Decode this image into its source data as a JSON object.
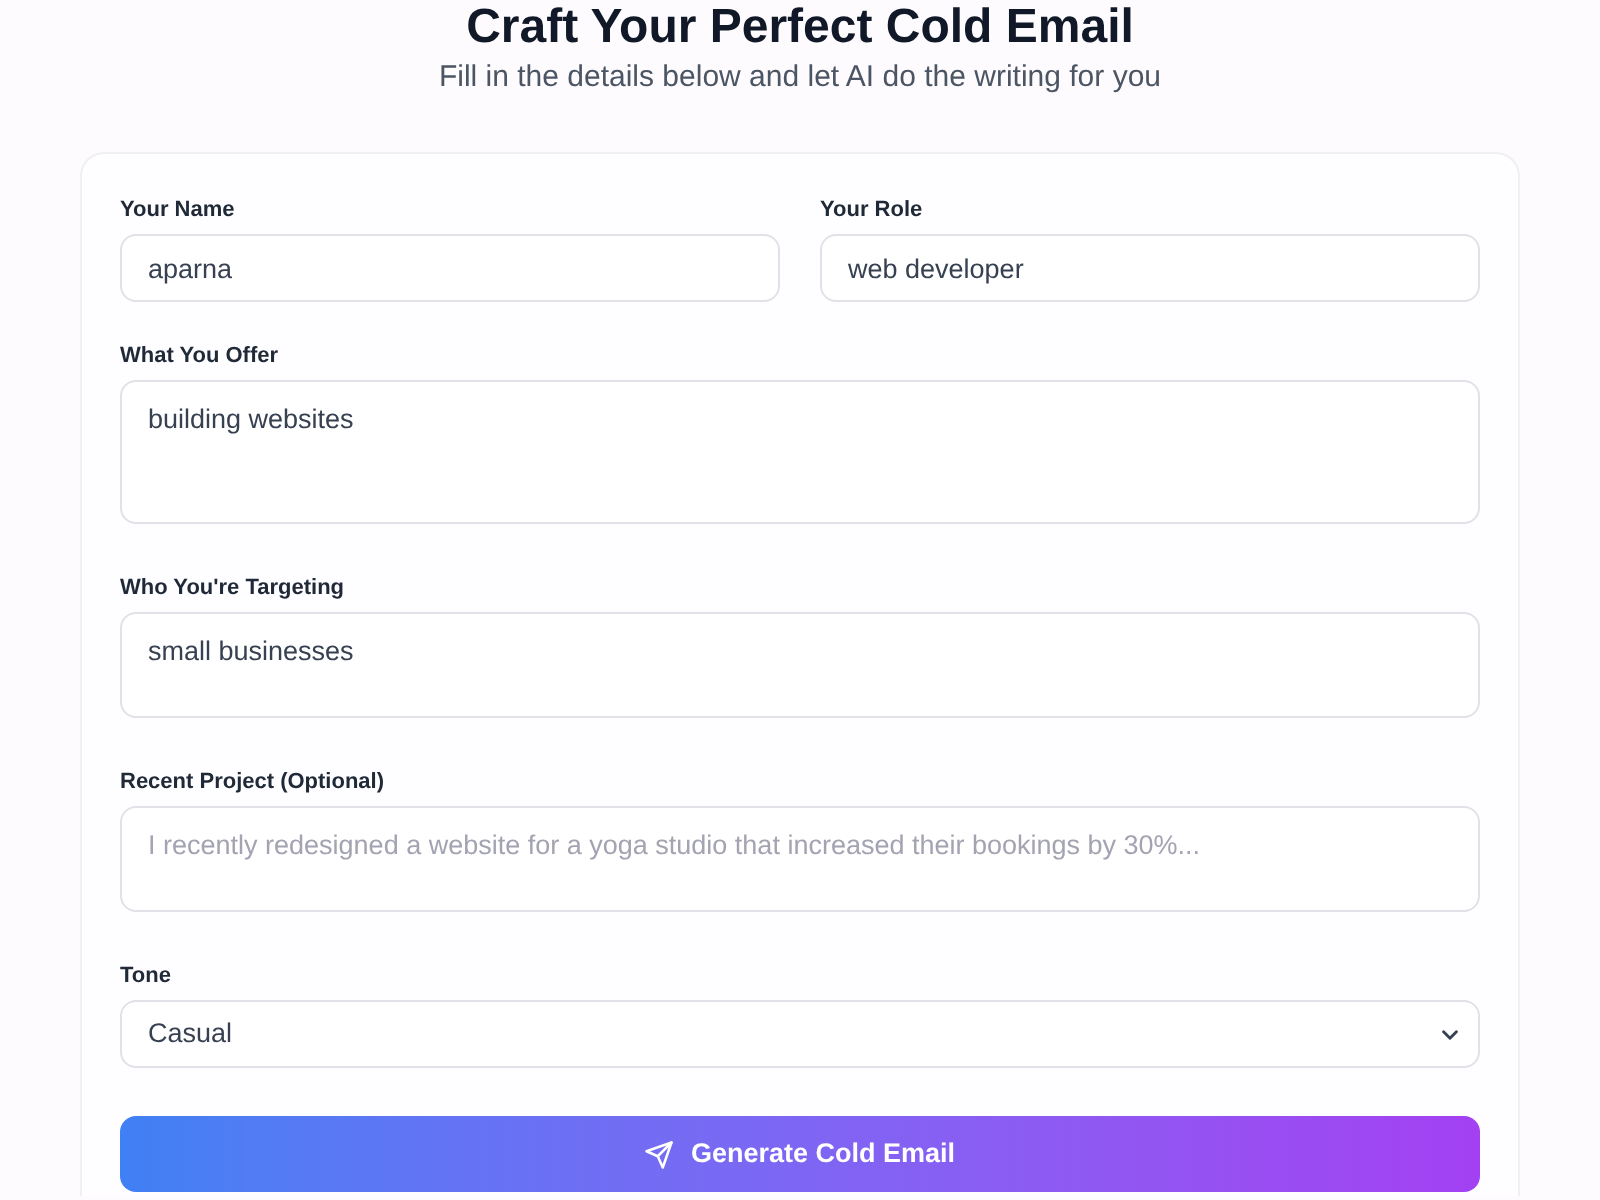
{
  "header": {
    "title": "Craft Your Perfect Cold Email",
    "subtitle": "Fill in the details below and let AI do the writing for you"
  },
  "form": {
    "rows": [
      [
        {
          "kind": "input",
          "label": "Your Name",
          "value": "aparna"
        },
        {
          "kind": "input",
          "label": "Your Role",
          "value": "web developer"
        }
      ],
      [
        {
          "kind": "textarea",
          "label": "What You Offer",
          "value": "building websites"
        }
      ],
      [
        {
          "kind": "textarea",
          "label": "Who You're Targeting",
          "value": "small businesses"
        }
      ],
      [
        {
          "kind": "textarea",
          "label": "Recent Project (Optional)",
          "placeholder": "I recently redesigned a website for a yoga studio that increased their bookings by 30%..."
        }
      ],
      [
        {
          "kind": "select",
          "label": "Tone",
          "value": "Casual"
        }
      ]
    ],
    "submit_button": {
      "label": "Generate Cold Email"
    }
  }
}
